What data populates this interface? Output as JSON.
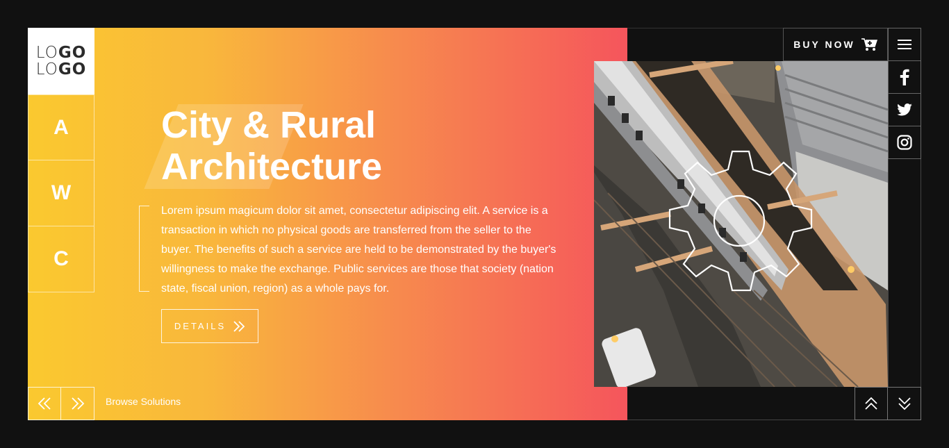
{
  "logo": {
    "line1_light": "LO",
    "line1_bold": "GO",
    "line2_light": "LO",
    "line2_bold": "GO"
  },
  "letters": [
    {
      "label": "A"
    },
    {
      "label": "W"
    },
    {
      "label": "C"
    }
  ],
  "hero": {
    "title_line1": "City & Rural",
    "title_line2": "Architecture",
    "body": "Lorem ipsum magicum dolor sit amet, consectetur adipiscing elit. A service is a transaction in which no physical goods are transferred from the seller to the buyer. The benefits of such a service are held to be demonstrated by the buyer's willingness to make the exchange. Public services are those that society (nation state, fiscal union, region) as a whole pays for.",
    "details_label": "DETAILS"
  },
  "footer": {
    "browse_label": "Browse Solutions"
  },
  "header": {
    "buy_now_label": "BUY NOW"
  },
  "icons": {
    "prev": "double-chevron-left-icon",
    "next": "double-chevron-right-icon",
    "details": "double-chevron-right-icon",
    "cart": "cart-icon",
    "menu": "hamburger-icon",
    "facebook": "facebook-icon",
    "twitter": "twitter-icon",
    "instagram": "instagram-icon",
    "up": "double-chevron-up-icon",
    "down": "double-chevron-down-icon",
    "gear": "gear-outline-icon"
  },
  "colors": {
    "gradient_start": "#fac92f",
    "gradient_end": "#f5555c",
    "background": "#111111",
    "text": "#ffffff"
  }
}
